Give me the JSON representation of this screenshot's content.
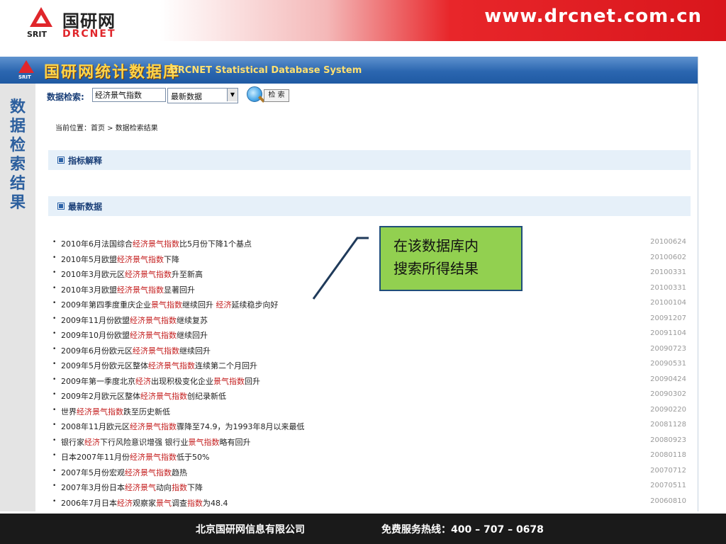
{
  "header": {
    "logo_cn": "国研网",
    "logo_srit": "SRIT",
    "logo_en": "DRCNET",
    "site_url": "www.drcnet.com.cn"
  },
  "app": {
    "banner_logo_text": "SRIT",
    "title": "国研网统计数据库",
    "subtitle": "DRCNET Statistical Database System",
    "side_label": "数据检索结果"
  },
  "search": {
    "label": "数据检索:",
    "keyword": "经济景气指数",
    "type_selected": "最新数据",
    "button_label": "检 索"
  },
  "breadcrumb": "当前位置：首页 > 数据检索结果",
  "sections": {
    "explain": "指标解释",
    "latest": "最新数据"
  },
  "results": [
    {
      "parts": [
        {
          "t": "2010年6月法国综合"
        },
        {
          "t": "经济景气指数",
          "hl": true
        },
        {
          "t": "比5月份下降1个基点"
        }
      ],
      "date": "20100624"
    },
    {
      "parts": [
        {
          "t": "2010年5月欧盟"
        },
        {
          "t": "经济景气指数",
          "hl": true
        },
        {
          "t": "下降"
        }
      ],
      "date": "20100602"
    },
    {
      "parts": [
        {
          "t": "2010年3月欧元区"
        },
        {
          "t": "经济景气指数",
          "hl": true
        },
        {
          "t": "升至新高"
        }
      ],
      "date": "20100331"
    },
    {
      "parts": [
        {
          "t": "2010年3月欧盟"
        },
        {
          "t": "经济景气指数",
          "hl": true
        },
        {
          "t": "显著回升"
        }
      ],
      "date": "20100331"
    },
    {
      "parts": [
        {
          "t": "2009年第四季度重庆企业"
        },
        {
          "t": "景气指数",
          "hl": true
        },
        {
          "t": "继续回升 "
        },
        {
          "t": "经济",
          "hl": true
        },
        {
          "t": "延续稳步向好"
        }
      ],
      "date": "20100104"
    },
    {
      "parts": [
        {
          "t": "2009年11月份欧盟"
        },
        {
          "t": "经济景气指数",
          "hl": true
        },
        {
          "t": "继续复苏"
        }
      ],
      "date": "20091207"
    },
    {
      "parts": [
        {
          "t": "2009年10月份欧盟"
        },
        {
          "t": "经济景气指数",
          "hl": true
        },
        {
          "t": "继续回升"
        }
      ],
      "date": "20091104"
    },
    {
      "parts": [
        {
          "t": "2009年6月份欧元区"
        },
        {
          "t": "经济景气指数",
          "hl": true
        },
        {
          "t": "继续回升"
        }
      ],
      "date": "20090723"
    },
    {
      "parts": [
        {
          "t": "2009年5月份欧元区整体"
        },
        {
          "t": "经济景气指数",
          "hl": true
        },
        {
          "t": "连续第二个月回升"
        }
      ],
      "date": "20090531"
    },
    {
      "parts": [
        {
          "t": "2009年第一季度北京"
        },
        {
          "t": "经济",
          "hl": true
        },
        {
          "t": "出现积极变化企业"
        },
        {
          "t": "景气指数",
          "hl": true
        },
        {
          "t": "回升"
        }
      ],
      "date": "20090424"
    },
    {
      "parts": [
        {
          "t": "2009年2月欧元区整体"
        },
        {
          "t": "经济景气指数",
          "hl": true
        },
        {
          "t": "创纪录新低"
        }
      ],
      "date": "20090302"
    },
    {
      "parts": [
        {
          "t": "世界"
        },
        {
          "t": "经济景气指数",
          "hl": true
        },
        {
          "t": "跌至历史新低"
        }
      ],
      "date": "20090220"
    },
    {
      "parts": [
        {
          "t": "2008年11月欧元区"
        },
        {
          "t": "经济景气指数",
          "hl": true
        },
        {
          "t": "骤降至74.9，为1993年8月以来最低"
        }
      ],
      "date": "20081128"
    },
    {
      "parts": [
        {
          "t": "银行家"
        },
        {
          "t": "经济",
          "hl": true
        },
        {
          "t": "下行风险意识增强 银行业"
        },
        {
          "t": "景气指数",
          "hl": true
        },
        {
          "t": "略有回升"
        }
      ],
      "date": "20080923"
    },
    {
      "parts": [
        {
          "t": "日本2007年11月份"
        },
        {
          "t": "经济景气指数",
          "hl": true
        },
        {
          "t": "低于50%"
        }
      ],
      "date": "20080118"
    },
    {
      "parts": [
        {
          "t": "2007年5月份宏观"
        },
        {
          "t": "经济景气指数",
          "hl": true
        },
        {
          "t": "趋热"
        }
      ],
      "date": "20070712"
    },
    {
      "parts": [
        {
          "t": "2007年3月份日本"
        },
        {
          "t": "经济景气",
          "hl": true
        },
        {
          "t": "动向"
        },
        {
          "t": "指数",
          "hl": true
        },
        {
          "t": "下降"
        }
      ],
      "date": "20070511"
    },
    {
      "parts": [
        {
          "t": "2006年7月日本"
        },
        {
          "t": "经济",
          "hl": true
        },
        {
          "t": "观察家"
        },
        {
          "t": "景气",
          "hl": true
        },
        {
          "t": "调查"
        },
        {
          "t": "指数",
          "hl": true
        },
        {
          "t": "为48.4"
        }
      ],
      "date": "20060810"
    }
  ],
  "callout": {
    "line1": "在该数据库内",
    "line2": "搜索所得结果"
  },
  "footer": {
    "company": "北京国研网信息有限公司",
    "hotline": "免费服务热线：400 – 707 – 0678"
  },
  "colors": {
    "highlight": "#c41e1e",
    "banner_blue": "#2b66b0",
    "callout_green": "#92d050",
    "header_red": "#e0262b"
  }
}
